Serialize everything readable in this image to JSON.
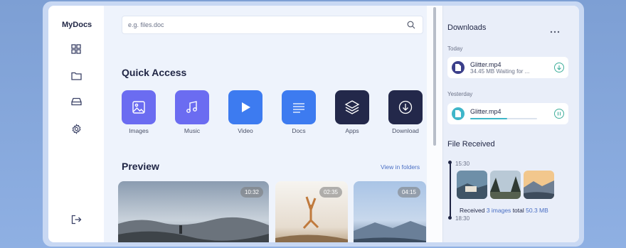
{
  "app": {
    "brand": "MyDocs"
  },
  "search": {
    "placeholder": "e.g. files.doc"
  },
  "quick_access": {
    "title": "Quick Access",
    "items": [
      {
        "label": "Images",
        "color": "#6b6cf1",
        "icon": "image-icon"
      },
      {
        "label": "Music",
        "color": "#6b6cf1",
        "icon": "music-icon"
      },
      {
        "label": "Video",
        "color": "#3d7bf0",
        "icon": "play-icon"
      },
      {
        "label": "Docs",
        "color": "#3d7bf0",
        "icon": "doc-icon"
      },
      {
        "label": "Apps",
        "color": "#23284a",
        "icon": "layers-icon"
      },
      {
        "label": "Download",
        "color": "#23284a",
        "icon": "download-icon"
      }
    ]
  },
  "preview": {
    "title": "Preview",
    "view_link": "View in folders",
    "videos": [
      {
        "duration": "10:32"
      },
      {
        "duration": "02:35"
      },
      {
        "duration": "04:15"
      }
    ]
  },
  "downloads": {
    "title": "Downloads",
    "more_icon": "more-icon",
    "today_label": "Today",
    "yesterday_label": "Yesterday",
    "today_file": {
      "name": "Glitter.mp4",
      "meta": "34.45 MB  Waiting for ..."
    },
    "yesterday_file": {
      "name": "Glitter.mp4",
      "progress": 0.55
    }
  },
  "file_received": {
    "title": "File Received",
    "time_start": "15:30",
    "time_end": "18:30",
    "received_word": "Received",
    "images_count": "3 images",
    "total_word": "total",
    "total_size": "50.3 MB"
  }
}
